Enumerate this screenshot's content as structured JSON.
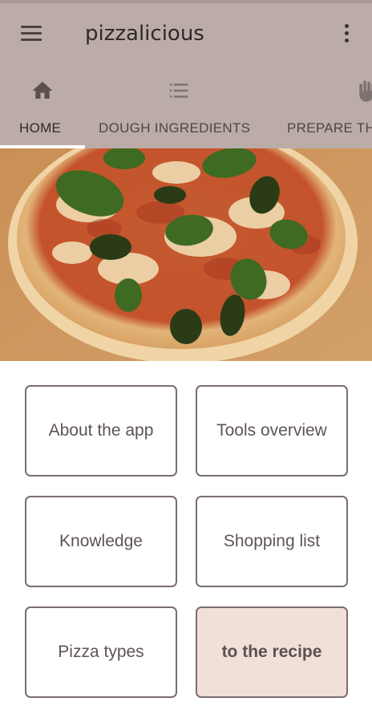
{
  "app_bar": {
    "title": "pizzalicious",
    "menu_icon": "hamburger-menu-icon",
    "overflow_icon": "more-vertical-icon",
    "background": "#bcaca8"
  },
  "tabs": [
    {
      "label": "HOME",
      "icon": "home-icon",
      "active": true
    },
    {
      "label": "DOUGH INGREDIENTS",
      "icon": "list-icon",
      "active": false
    },
    {
      "label": "PREPARE THE DOUGH",
      "icon": "hand-icon",
      "active": false
    }
  ],
  "hero": {
    "image": "pizza-margherita-photo"
  },
  "buttons": {
    "about": "About the app",
    "tools": "Tools overview",
    "knowledge": "Knowledge",
    "shopping": "Shopping list",
    "pizza_types": "Pizza types",
    "recipe": "to the recipe"
  },
  "colors": {
    "button_border": "#7a6e6b",
    "primary_button_bg": "#f0e0d8"
  }
}
